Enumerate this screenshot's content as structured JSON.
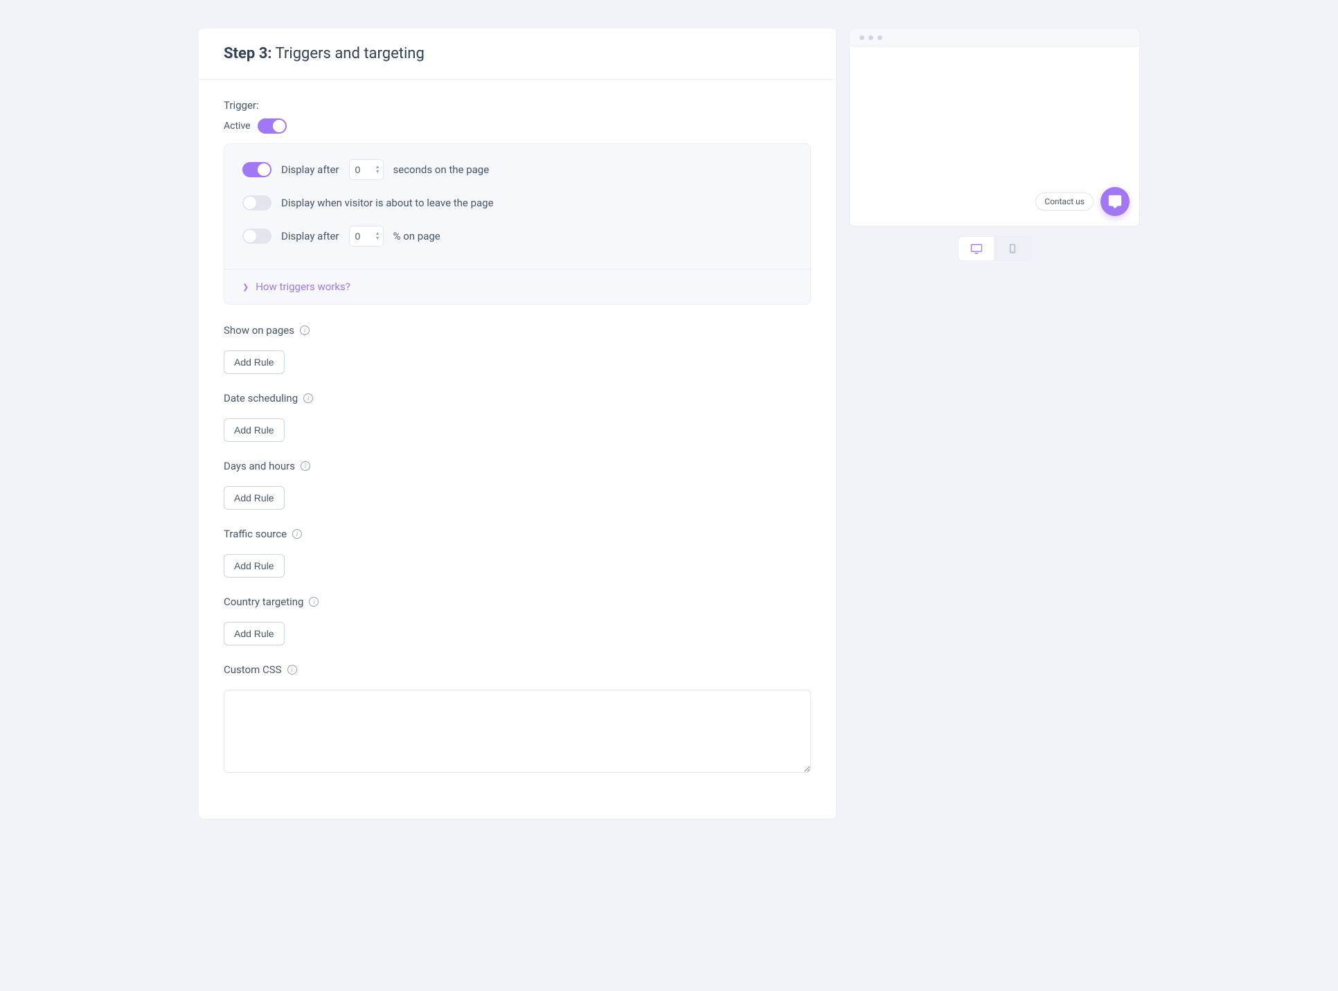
{
  "header": {
    "step_prefix": "Step 3:",
    "step_title": " Triggers and targeting"
  },
  "trigger": {
    "label": "Trigger:",
    "active_label": "Active",
    "active_on": true,
    "items": {
      "delay": {
        "on": true,
        "prefix": "Display after",
        "value": "0",
        "suffix": "seconds on the page"
      },
      "exit": {
        "on": false,
        "label": "Display when visitor is about to leave the page"
      },
      "scroll": {
        "on": false,
        "prefix": "Display after",
        "value": "0",
        "suffix": "% on page"
      }
    },
    "help_link": "How triggers works?"
  },
  "sections": {
    "show_on_pages": {
      "label": "Show on pages",
      "button": "Add Rule"
    },
    "date_scheduling": {
      "label": "Date scheduling",
      "button": "Add Rule"
    },
    "days_hours": {
      "label": "Days and hours",
      "button": "Add Rule"
    },
    "traffic_source": {
      "label": "Traffic source",
      "button": "Add Rule"
    },
    "country_targeting": {
      "label": "Country targeting",
      "button": "Add Rule"
    },
    "custom_css": {
      "label": "Custom CSS"
    }
  },
  "preview": {
    "contact_label": "Contact us"
  }
}
